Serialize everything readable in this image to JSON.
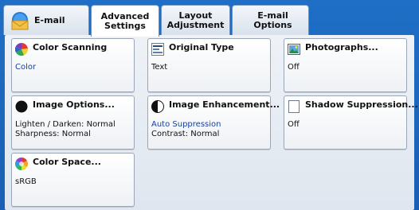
{
  "tabs": [
    {
      "label": "E-mail"
    },
    {
      "label": "Advanced\nSettings"
    },
    {
      "label": "Layout\nAdjustment"
    },
    {
      "label": "E-mail Options"
    }
  ],
  "buttons": {
    "color_scanning": {
      "title": "Color Scanning",
      "value": "Color"
    },
    "original_type": {
      "title": "Original Type",
      "value": "Text"
    },
    "photographs": {
      "title": "Photographs...",
      "value": "Off"
    },
    "image_options": {
      "title": "Image Options...",
      "line1": "Lighten / Darken: Normal",
      "line2": "Sharpness: Normal"
    },
    "image_enhancement": {
      "title": "Image Enhancement...",
      "line1": "Auto Suppression",
      "line2": "Contrast: Normal"
    },
    "shadow_suppression": {
      "title": "Shadow Suppression...",
      "value": "Off"
    },
    "color_space": {
      "title": "Color Space...",
      "value": "sRGB"
    }
  },
  "colors": {
    "background": "#1a5fb3",
    "panel": "#e6ebf2",
    "value_blue": "#1a3f9a"
  },
  "icons": [
    "email-envelope-icon",
    "color-wheel-icon",
    "document-icon",
    "photo-icon",
    "black-circle-icon",
    "half-circle-icon",
    "blank-page-icon",
    "rainbow-circle-icon"
  ]
}
